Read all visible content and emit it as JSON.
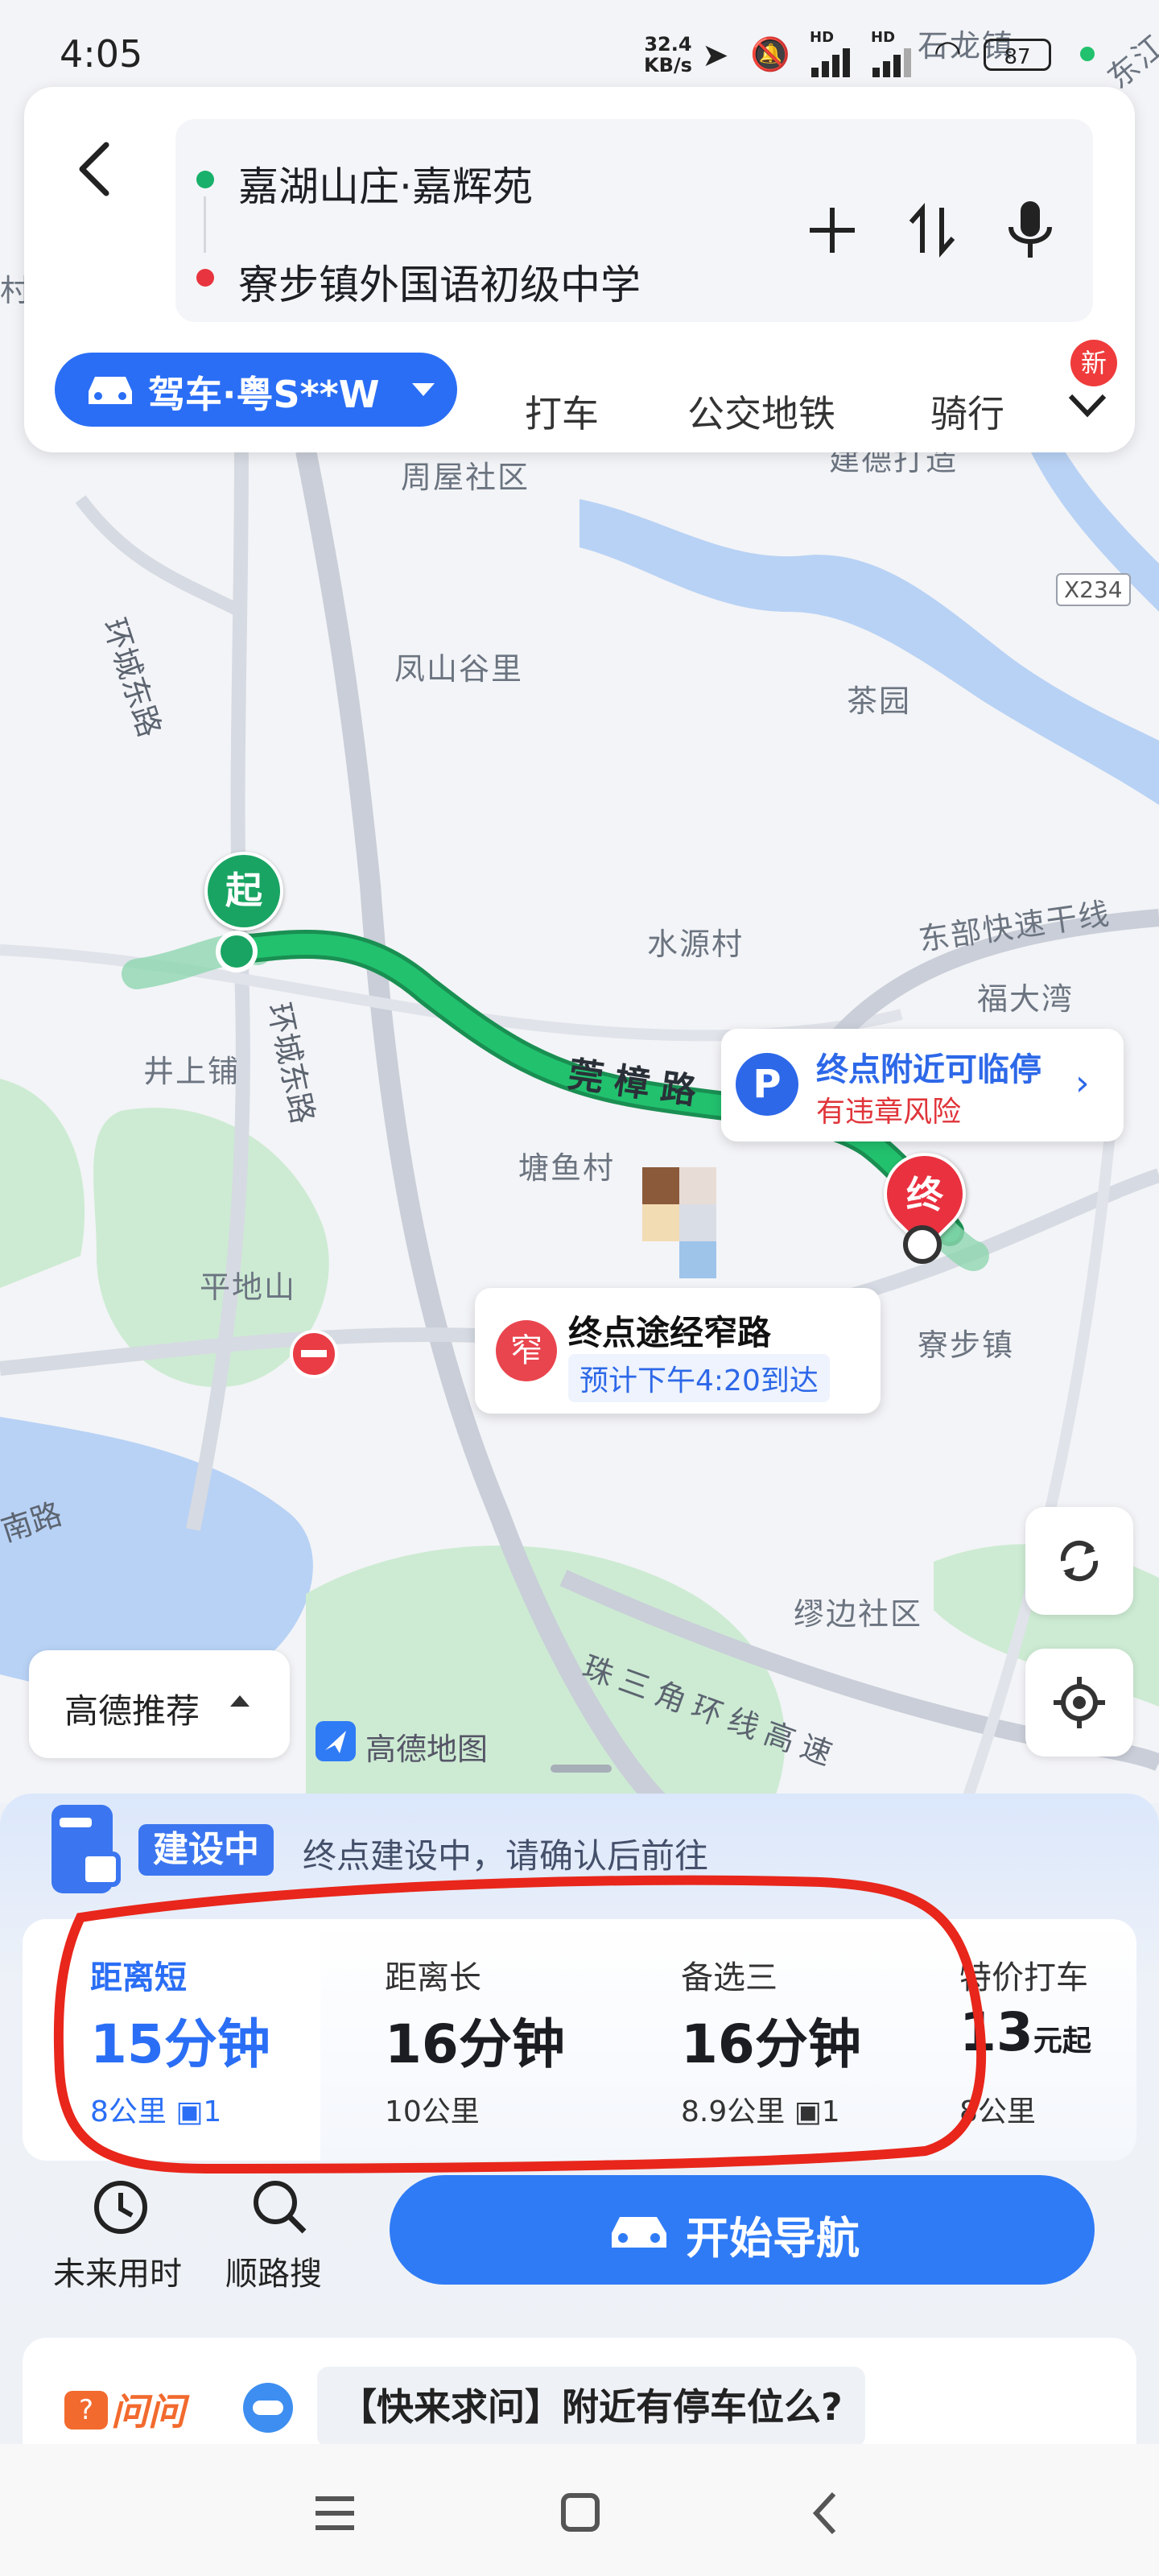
{
  "status_bar": {
    "time": "4:05",
    "net_speed_value": "32.4",
    "net_speed_unit": "KB/s",
    "battery": "87",
    "hd1": "HD",
    "hd2": "HD"
  },
  "search": {
    "origin": "嘉湖山庄·嘉辉苑",
    "destination": "寮步镇外国语初级中学"
  },
  "modes": {
    "drive_label": "驾车·粤S**W",
    "taxi": "打车",
    "transit": "公交地铁",
    "ride": "骑行",
    "new_badge": "新"
  },
  "map": {
    "labels": [
      "周屋社区",
      "凤山谷里",
      "茶园",
      "水源村",
      "东部快速干线",
      "福大湾",
      "井上铺",
      "塘鱼村",
      "平地山",
      "寮步镇",
      "缪边社区",
      "石龙镇",
      "东江",
      "建德打造",
      "村"
    ],
    "road_labels": [
      "环城东路",
      "环城东路",
      "莞樟路",
      "南路",
      "珠三角环线高速"
    ],
    "x234": "X234",
    "start_marker": "起",
    "end_marker": "终",
    "brand": "高德地图",
    "parking_title": "终点附近可临停",
    "parking_sub": "有违章风险",
    "narrow_icon": "窄",
    "narrow_title": "终点途经窄路",
    "narrow_sub": "预计下午4:20到达",
    "recommend": "高德推荐"
  },
  "construction": {
    "tag": "建设中",
    "text": "终点建设中，请确认后前往"
  },
  "routes": [
    {
      "label": "距离短",
      "time_num": "15",
      "time_unit": "分钟",
      "dist": "8公里",
      "lights": "1"
    },
    {
      "label": "距离长",
      "time_num": "16",
      "time_unit": "分钟",
      "dist": "10公里",
      "lights": ""
    },
    {
      "label": "备选三",
      "time_num": "16",
      "time_unit": "分钟",
      "dist": "8.9公里",
      "lights": "1"
    },
    {
      "label": "特价打车",
      "price_num": "13",
      "price_unit": "元起",
      "dist": "8公里"
    }
  ],
  "actions": {
    "future": "未来用时",
    "along_search": "顺路搜",
    "start_nav": "开始导航"
  },
  "ask": {
    "brand": "问问",
    "question": "【快来求问】附近有停车位么?"
  },
  "colors": {
    "accent": "#2f7bf6",
    "route": "#13b464",
    "selected": "#2a6ef5",
    "annotation": "#e8261b"
  }
}
